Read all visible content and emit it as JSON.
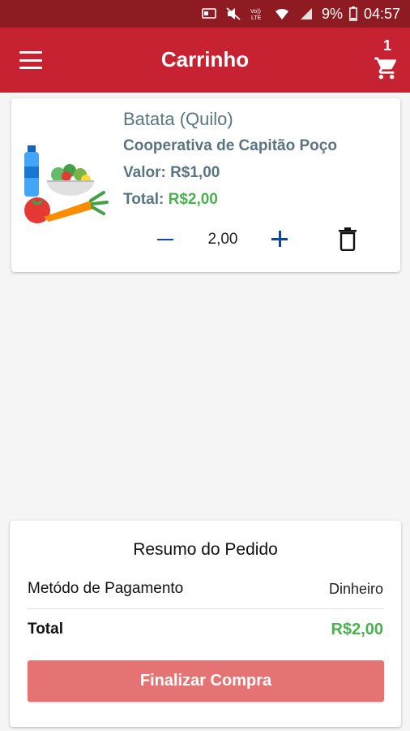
{
  "status_bar": {
    "battery": "9%",
    "time": "04:57",
    "icons": [
      "cast-icon",
      "mute-icon",
      "volte-icon",
      "wifi-icon",
      "signal-icon",
      "battery-icon"
    ]
  },
  "app_bar": {
    "title": "Carrinho",
    "cart_count": "1",
    "color": "#c62231"
  },
  "cart_items": [
    {
      "name": "Batata (Quilo)",
      "cooperative": "Cooperativa de Capitão Poço",
      "price_label": "Valor: R$1,00",
      "total_label": "Total: ",
      "total_value": "R$2,00",
      "quantity": "2,00"
    }
  ],
  "summary": {
    "title": "Resumo do Pedido",
    "payment_label": "Metódo de Pagamento",
    "payment_value": "Dinheiro",
    "total_label": "Total",
    "total_value": "R$2,00",
    "finalize_label": "Finalizar Compra"
  },
  "colors": {
    "status_bar": "#8e1b22",
    "accent_green": "#4caf50",
    "button": "#e57373",
    "qty_controls": "#0d47a1"
  }
}
